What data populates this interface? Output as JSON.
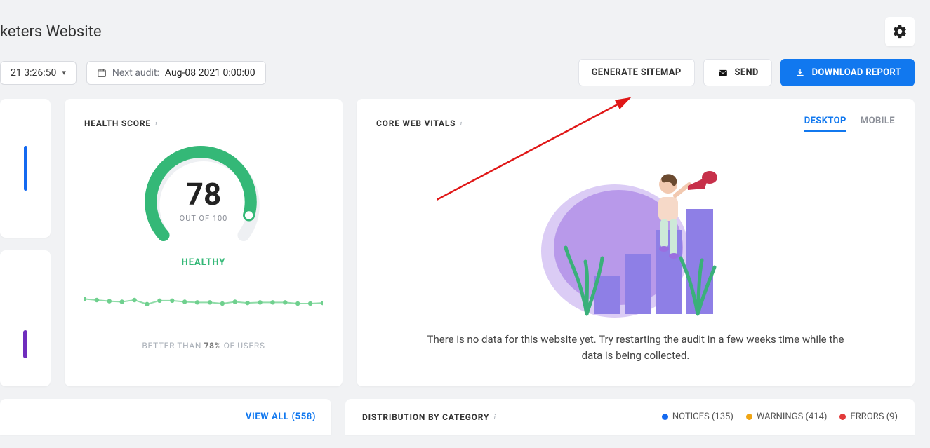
{
  "header": {
    "title": "keters Website"
  },
  "controls": {
    "date_dropdown": "21 3:26:50",
    "next_audit_label": "Next audit:",
    "next_audit_value": "Aug-08 2021 0:00:00"
  },
  "actions": {
    "generate_sitemap": "GENERATE SITEMAP",
    "send": "SEND",
    "download_report": "DOWNLOAD REPORT"
  },
  "health": {
    "title": "HEALTH SCORE",
    "score": "78",
    "outof": "OUT OF 100",
    "status": "HEALTHY",
    "better_prefix": "BETTER THAN ",
    "better_pct": "78%",
    "better_suffix": " OF USERS"
  },
  "vitals": {
    "title": "CORE WEB VITALS",
    "tab_desktop": "DESKTOP",
    "tab_mobile": "MOBILE",
    "message": "There is no data for this website yet. Try restarting the audit in a few weeks time while the data is being collected."
  },
  "bottom": {
    "view_all_label": "VIEW ALL (558)",
    "dist_title": "DISTRIBUTION BY CATEGORY",
    "legend": {
      "notices": "NOTICES (135)",
      "warnings": "WARNINGS (414)",
      "errors": "ERRORS (9)"
    }
  },
  "chart_data": {
    "gauge": {
      "type": "gauge",
      "value": 78,
      "max": 100,
      "status": "Healthy",
      "color": "#34b877"
    },
    "sparkline": {
      "type": "line",
      "values": [
        38,
        36,
        34,
        33,
        36,
        29,
        35,
        35,
        33,
        32,
        32,
        30,
        33,
        31,
        32,
        32,
        32,
        30,
        30,
        31
      ],
      "ylim": [
        0,
        60
      ],
      "color": "#6fd08e"
    }
  }
}
